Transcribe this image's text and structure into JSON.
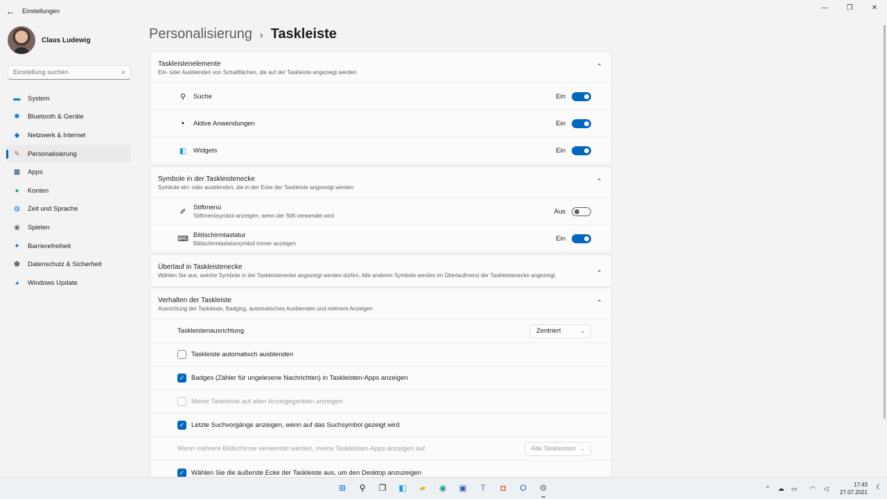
{
  "window": {
    "title": "Einstellungen",
    "back_icon": "←",
    "minimize": "—",
    "maximize": "❐",
    "close": "✕"
  },
  "profile": {
    "name": "Claus Ludewig"
  },
  "search": {
    "placeholder": "Einstellung suchen",
    "icon": "⌕"
  },
  "nav": [
    {
      "label": "System",
      "icon": "▬",
      "color": "#0078d4"
    },
    {
      "label": "Bluetooth & Geräte",
      "icon": "✱",
      "color": "#0078d4"
    },
    {
      "label": "Netzwerk & Internet",
      "icon": "◆",
      "color": "#0078d4"
    },
    {
      "label": "Personalisierung",
      "icon": "✎",
      "color": "#c0541c",
      "active": true
    },
    {
      "label": "Apps",
      "icon": "▦",
      "color": "#2b4a70"
    },
    {
      "label": "Konten",
      "icon": "●",
      "color": "#20a090"
    },
    {
      "label": "Zeit und Sprache",
      "icon": "◍",
      "color": "#1d74d8"
    },
    {
      "label": "Spielen",
      "icon": "◉",
      "color": "#6a6a6a"
    },
    {
      "label": "Barrierefreiheit",
      "icon": "✦",
      "color": "#1a5fb4"
    },
    {
      "label": "Datenschutz & Sicherheit",
      "icon": "⬟",
      "color": "#6b6b7b"
    },
    {
      "label": "Windows Update",
      "icon": "◕",
      "color": "#0078d4"
    }
  ],
  "breadcrumb": {
    "parent": "Personalisierung",
    "separator": "›",
    "current": "Taskleiste"
  },
  "sections": {
    "elements": {
      "title": "Taskleistenelemente",
      "subtitle": "Ein- oder Ausblenden von Schaltflächen, die auf der Taskleiste angezeigt werden",
      "chevron": "⌃",
      "rows": [
        {
          "label": "Suche",
          "state": "Ein",
          "icon": "⚲"
        },
        {
          "label": "Aktive Anwendungen",
          "state": "Ein",
          "icon": "▪"
        },
        {
          "label": "Widgets",
          "state": "Ein",
          "icon": "◧"
        }
      ]
    },
    "corner": {
      "title": "Symbole in der Taskleistenecke",
      "subtitle": "Symbole ein- oder ausblenden, die in der Ecke der Taskleiste angezeigt werden",
      "chevron": "⌃",
      "rows": [
        {
          "label": "Stiftmenü",
          "sub": "Stiftmenüsymbol anzeigen, wenn der Stift verwendet wird",
          "state": "Aus",
          "icon": "✐"
        },
        {
          "label": "Bildschirmtastatur",
          "sub": "Bildschirmtastatursymbol immer anzeigen",
          "state": "Ein",
          "icon": "⌨"
        }
      ]
    },
    "overflow": {
      "title": "Überlauf in Taskleistenecke",
      "subtitle": "Wählen Sie aus, welche Symbole in der Taskleistenecke angezeigt werden dürfen. Alle anderen Symbole werden im Überlaufmenü der Taskleistenecke angezeigt.",
      "chevron": "⌄"
    },
    "behavior": {
      "title": "Verhalten der Taskleiste",
      "subtitle": "Ausrichtung der Taskleiste, Badging, automatisches Ausblenden und mehrere Anzeigen",
      "chevron": "⌃",
      "alignment_label": "Taskleistenausrichtung",
      "alignment_value": "Zentriert",
      "dd_chevron": "⌄",
      "checks": [
        {
          "label": "Taskleiste automatisch ausblenden",
          "checked": false
        },
        {
          "label": "Badges (Zähler für ungelesene Nachrichten) in Taskleisten-Apps anzeigen",
          "checked": true
        },
        {
          "label": "Meine Taskleiste auf allen Anzeigegeräten anzeigen",
          "checked": false,
          "disabled": true
        },
        {
          "label": "Letzte Suchvorgänge anzeigen, wenn auf das Suchsymbol gezeigt wird",
          "checked": true
        }
      ],
      "multi_label": "Wenn mehrere Bildschirme verwendet werden, meine Taskleisten-Apps anzeigen auf",
      "multi_value": "Alle Taskleisten",
      "last_check": "Wählen Sie die äußerste Ecke der Taskleiste aus, um den Desktop anzuzeigen",
      "check_mark": "✓"
    }
  },
  "taskbar": {
    "apps": [
      {
        "name": "start-icon",
        "glyph": "⊞",
        "color": "#0078d4"
      },
      {
        "name": "search-icon",
        "glyph": "⚲",
        "color": "#111111"
      },
      {
        "name": "task-view-icon",
        "glyph": "❐",
        "color": "#222222"
      },
      {
        "name": "widgets-icon",
        "glyph": "◧",
        "color": "#1a9be0"
      },
      {
        "name": "file-explorer-icon",
        "glyph": "▰",
        "color": "#e8b33a"
      },
      {
        "name": "edge-icon",
        "glyph": "◉",
        "color": "#1a9b8c"
      },
      {
        "name": "store-icon",
        "glyph": "▣",
        "color": "#2a60b0"
      },
      {
        "name": "teams-icon",
        "glyph": "T",
        "color": "#5b5fc7"
      },
      {
        "name": "office-icon",
        "glyph": "◘",
        "color": "#d83b01"
      },
      {
        "name": "outlook-icon",
        "glyph": "O",
        "color": "#0a64ad"
      },
      {
        "name": "settings-icon",
        "glyph": "⚙",
        "color": "#5a6a7a",
        "active": true
      }
    ],
    "tray": {
      "chevron": "⌃",
      "cloud": "☁",
      "monitor": "▭",
      "wifi": "◠",
      "volume": "◁"
    },
    "time": "17:43",
    "date": "27.07.2021",
    "notification": "☾"
  }
}
